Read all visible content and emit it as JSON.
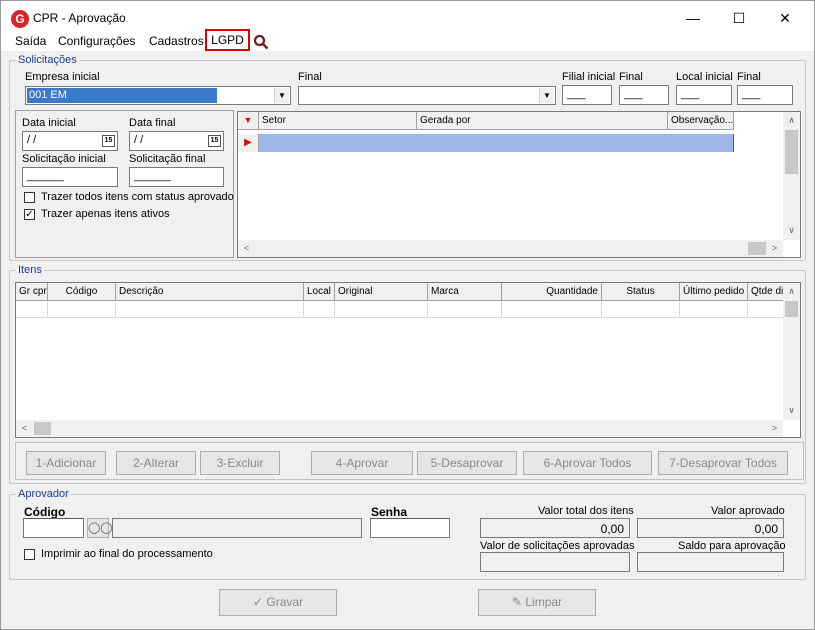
{
  "window": {
    "title": "CPR - Aprovação",
    "minimize": "—",
    "maximize": "☐",
    "close": "✕",
    "app_icon": "G"
  },
  "menu": {
    "items": [
      "Saída",
      "Configurações",
      "Cadastros"
    ],
    "lgpd": "LGPD"
  },
  "solicitacoes": {
    "legend": "Solicitações",
    "empresa_inicial_label": "Empresa inicial",
    "empresa_inicial_value": "001 EM",
    "final_label": "Final",
    "filial_inicial_label": "Filial inicial",
    "filial_final_label": "Final",
    "local_inicial_label": "Local inicial",
    "local_final_label": "Final",
    "dash_value": "___",
    "data_inicial_label": "Data inicial",
    "data_final_label": "Data final",
    "date_value": " / /",
    "cal_icon": "15",
    "sol_inicial_label": "Solicitação inicial",
    "sol_final_label": "Solicitação final",
    "sol_value": "______",
    "chk_aprovado_label": "Trazer todos itens com status aprovado",
    "chk_ativos_label": "Trazer apenas itens ativos",
    "grid_columns": [
      "Setor",
      "Gerada por",
      "Observação..."
    ]
  },
  "itens": {
    "legend": "Itens",
    "columns": [
      "Gr cpr",
      "Código",
      "Descrição",
      "Local",
      "Original",
      "Marca",
      "Quantidade",
      "Status",
      "Último pedido",
      "Qtde dis"
    ]
  },
  "actions": [
    "1-Adicionar",
    "2-Alterar",
    "3-Excluir",
    "4-Aprovar",
    "5-Desaprovar",
    "6-Aprovar Todos",
    "7-Desaprovar Todos"
  ],
  "aprovador": {
    "legend": "Aprovador",
    "codigo_label": "Código",
    "senha_label": "Senha",
    "valor_total_label": "Valor total dos itens",
    "valor_total": "0,00",
    "valor_aprovado_label": "Valor aprovado",
    "valor_aprovado": "0,00",
    "valor_solic_label": "Valor de solicitações aprovadas",
    "saldo_label": "Saldo para aprovação",
    "imprimir_label": "Imprimir ao final do processamento"
  },
  "footer": {
    "gravar": "Gravar",
    "limpar": "Limpar"
  }
}
